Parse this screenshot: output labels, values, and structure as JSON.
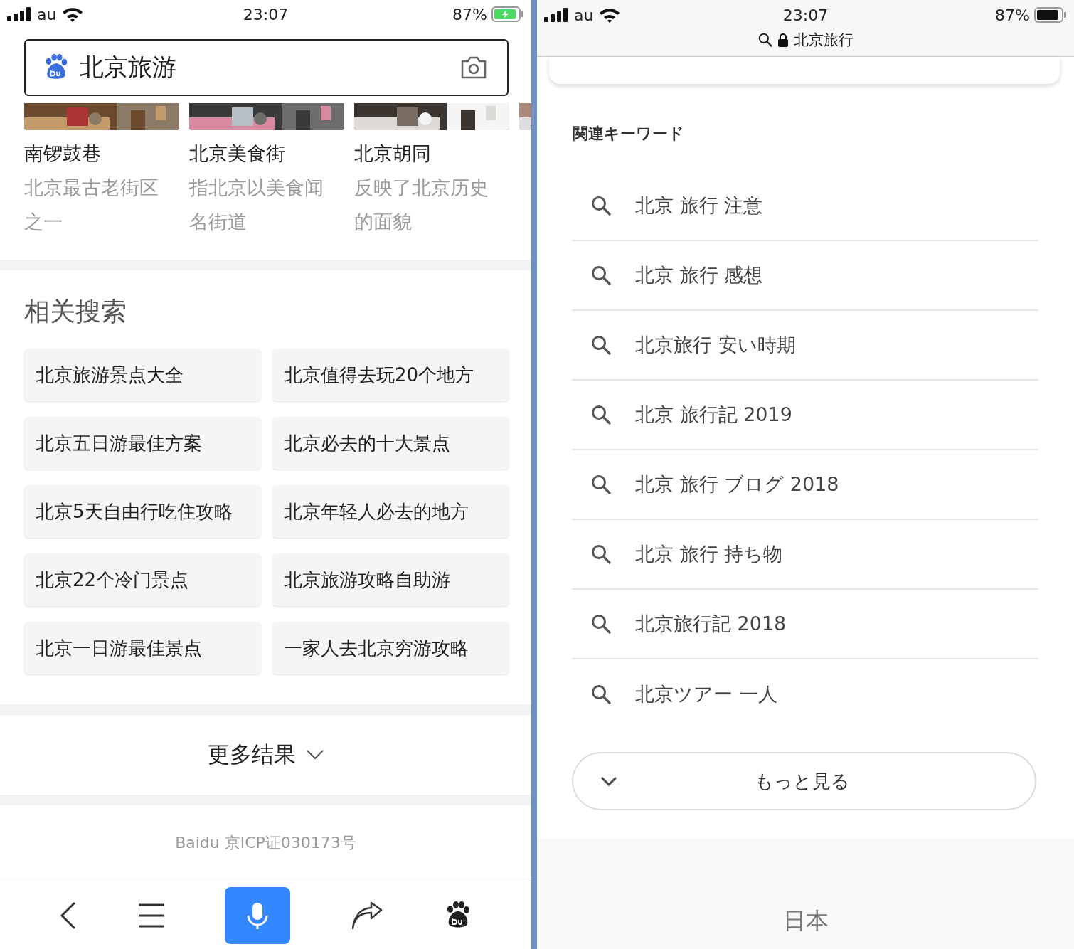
{
  "left": {
    "status_bar": {
      "carrier": "au",
      "time": "23:07",
      "battery": "87%",
      "charging": true
    },
    "search": {
      "value": "北京旅游"
    },
    "cards": [
      {
        "title": "南锣鼓巷",
        "desc": "北京最古老街区之一"
      },
      {
        "title": "北京美食街",
        "desc": "指北京以美食闻名街道"
      },
      {
        "title": "北京胡同",
        "desc": "反映了北京历史的面貌"
      }
    ],
    "related": {
      "title": "相关搜索",
      "items": [
        "北京旅游景点大全",
        "北京值得去玩20个地方",
        "北京五日游最佳方案",
        "北京必去的十大景点",
        "北京5天自由行吃住攻略",
        "北京年轻人必去的地方",
        "北京22个冷门景点",
        "北京旅游攻略自助游",
        "北京一日游最佳景点",
        "一家人去北京穷游攻略"
      ]
    },
    "more": "更多结果",
    "footer": "Baidu 京ICP证030173号"
  },
  "right": {
    "status_bar": {
      "carrier": "au",
      "time": "23:07",
      "battery": "87%",
      "charging": false
    },
    "url": "北京旅行",
    "heading": "関連キーワード",
    "keywords": [
      "北京 旅行 注意",
      "北京 旅行 感想",
      "北京旅行 安い時期",
      "北京 旅行記 2019",
      "北京 旅行 ブログ 2018",
      "北京 旅行 持ち物",
      "北京旅行記 2018",
      "北京ツアー 一人"
    ],
    "more": "もっと見る",
    "footer": "日本"
  }
}
